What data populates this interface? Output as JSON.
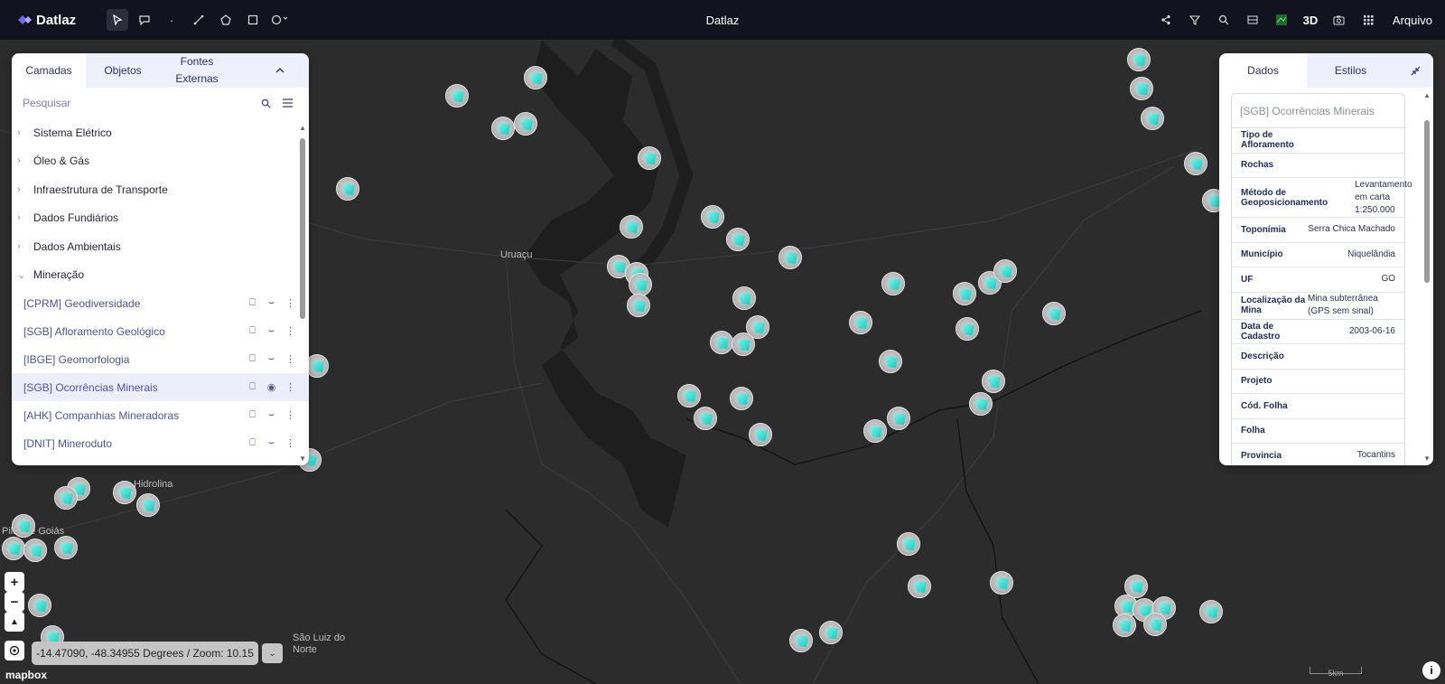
{
  "app": {
    "logo_text": "Datlaz",
    "title": "Datlaz"
  },
  "toolbar_right": {
    "three_d": "3D",
    "file_menu": "Arquivo"
  },
  "left_panel": {
    "tabs": [
      "Camadas",
      "Objetos",
      "Fontes Externas"
    ],
    "search_placeholder": "Pesquisar",
    "groups": [
      "Sistema Elétrico",
      "Óleo & Gás",
      "Infraestrutura de Transporte",
      "Dados Fundiários",
      "Dados Ambientais",
      "Mineração"
    ],
    "layers": [
      "[CPRM] Geodiversidade",
      "[SGB] Afloramento Geológico",
      "[IBGE] Geomorfologia",
      "[SGB] Ocorrências Minerais",
      "[AHK] Companhias Mineradoras",
      "[DNIT] Mineroduto"
    ],
    "selected_layer": "[SGB] Ocorrências Minerais"
  },
  "right_panel": {
    "tabs": [
      "Dados",
      "Estilos"
    ],
    "card_title": "[SGB] Ocorrências Minerais",
    "rows": [
      {
        "key": "Tipo de Afloramento",
        "value": ""
      },
      {
        "key": "Rochas",
        "value": ""
      },
      {
        "key": "Método de Geoposicionamento",
        "value": "Levantamento em carta 1:250.000"
      },
      {
        "key": "Toponímia",
        "value": "Serra Chica Machado"
      },
      {
        "key": "Município",
        "value": "Niquelândia"
      },
      {
        "key": "UF",
        "value": "GO"
      },
      {
        "key": "Localização da Mina",
        "value": "Mina subterrânea (GPS sem sinal)"
      },
      {
        "key": "Data de Cadastro",
        "value": "2003-06-16"
      },
      {
        "key": "Descrição",
        "value": ""
      },
      {
        "key": "Projeto",
        "value": ""
      },
      {
        "key": "Cód. Folha",
        "value": ""
      },
      {
        "key": "Folha",
        "value": ""
      },
      {
        "key": "Provincia",
        "value": "Tocantins"
      }
    ]
  },
  "map": {
    "labels": [
      "Uruaçu",
      "Hidrolina",
      "Pilar de Goiás",
      "São Luiz do Norte"
    ],
    "coordinates": "-14.47090, -48.34955 Degrees / Zoom: 10.15",
    "zoom_in": "+",
    "zoom_out": "−",
    "attribution": "mapbox",
    "scale": "5km",
    "info": "i"
  },
  "colors": {
    "topbar": "#13131f",
    "map_bg": "#2c2c2c",
    "accent": "#4a51a8",
    "pin_gem": "#12c9c0"
  }
}
